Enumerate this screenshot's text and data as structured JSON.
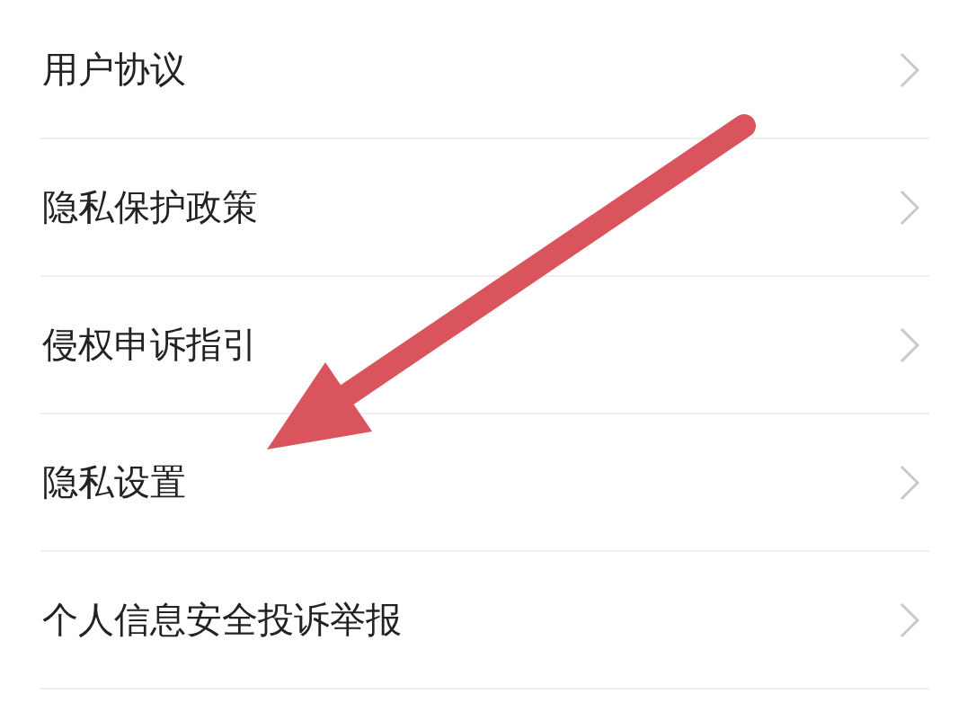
{
  "menu_items": [
    {
      "label": "用户协议"
    },
    {
      "label": "隐私保护政策"
    },
    {
      "label": "侵权申诉指引"
    },
    {
      "label": "隐私设置"
    },
    {
      "label": "个人信息安全投诉举报"
    }
  ]
}
